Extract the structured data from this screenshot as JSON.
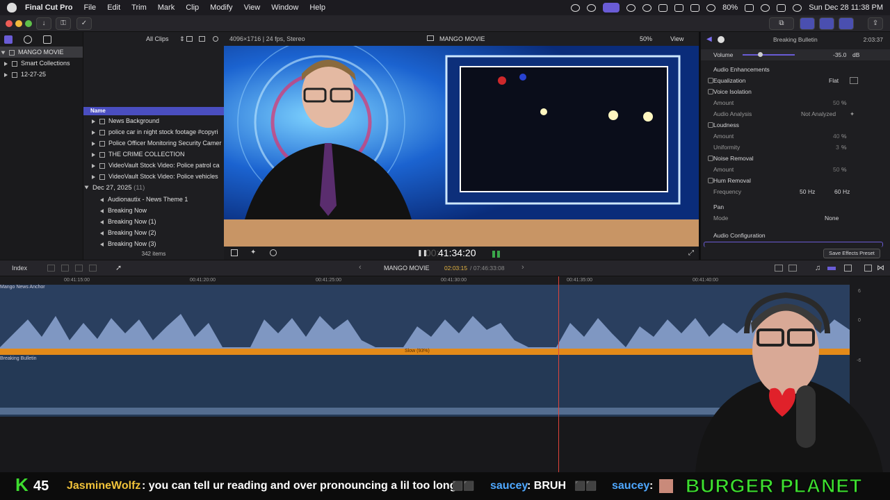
{
  "menubar": {
    "app_name": "Final Cut Pro",
    "items": [
      "File",
      "Edit",
      "Trim",
      "Mark",
      "Clip",
      "Modify",
      "View",
      "Window",
      "Help"
    ],
    "battery": "80%",
    "datetime": "Sun Dec 28  11:38 PM"
  },
  "library": {
    "name": "MANGO MOVIE",
    "items": [
      "Smart Collections",
      "12-27-25"
    ]
  },
  "browser": {
    "filter": "All Clips",
    "column_name": "Name",
    "clips": [
      "News Background",
      "police  car in night stock footage #copyri",
      "Police Officer Monitoring Security Camer",
      "THE CRIME COLLECTION",
      "VideoVault Stock Video:   Police patrol ca",
      "VideoVault Stock Video:   Police vehicles"
    ],
    "event_date": "Dec 27, 2025",
    "event_count": "(11)",
    "event_clips": [
      "Audionautix - News Theme 1",
      "Breaking Now",
      "Breaking Now (1)",
      "Breaking Now (2)",
      "Breaking Now (3)"
    ],
    "item_count": "342 items"
  },
  "viewer": {
    "format": "4096×1716 | 24 fps, Stereo",
    "title": "MANGO MOVIE",
    "zoom": "50%",
    "view": "View",
    "timecode": "41:34:20",
    "timecode_prefix": "00:"
  },
  "inspector": {
    "clip_name": "Breaking Bulletin",
    "duration": "2:03:37",
    "volume_label": "Volume",
    "volume_value": "-35.0",
    "volume_unit": "dB",
    "section_enhancements": "Audio Enhancements",
    "equalization": "Equalization",
    "eq_value": "Flat",
    "voice_isolation": "Voice Isolation",
    "amount": "Amount",
    "vi_amount": "50",
    "audio_analysis": "Audio Analysis",
    "analysis_value": "Not Analyzed",
    "loudness": "Loudness",
    "loud_amount": "40",
    "uniformity": "Uniformity",
    "uniformity_value": "3",
    "noise_removal": "Noise Removal",
    "nr_amount": "50",
    "hum_removal": "Hum Removal",
    "frequency": "Frequency",
    "freq_50": "50",
    "freq_60": "60",
    "hz": "Hz",
    "pct": "%",
    "pan": "Pan",
    "mode": "Mode",
    "mode_value": "None",
    "audio_config": "Audio Configuration",
    "save_preset": "Save Effects Preset"
  },
  "timeline": {
    "index": "Index",
    "project": "MANGO MOVIE",
    "position": "02:03:15",
    "total": "/ 07:46:33:08",
    "ticks": [
      "00:41:15:00",
      "00:41:20:00",
      "00:41:25:00",
      "00:41:30:00",
      "00:41:35:00",
      "00:41:40:00"
    ],
    "clip1": "Mango News Anchor",
    "retime": "Slow (93%)",
    "clip2": "Breaking Bulletin",
    "meter_labels": [
      "6",
      "0",
      "-6"
    ]
  },
  "ticker": {
    "k_count": "45",
    "user1": "JasmineWolfz",
    "msg1": ": you can tell ur reading and over pronouncing a lil too long",
    "user2": "saucey",
    "msg2": ": BRUH",
    "user3": "saucey",
    "msg3": ":",
    "brand": "BURGER PLANET"
  },
  "colors": {
    "accent": "#6a5cd6",
    "playhead": "#e0443a",
    "retime": "#e38a19",
    "ticker_user": "#f0c23a",
    "brand": "#3ddc2f"
  }
}
